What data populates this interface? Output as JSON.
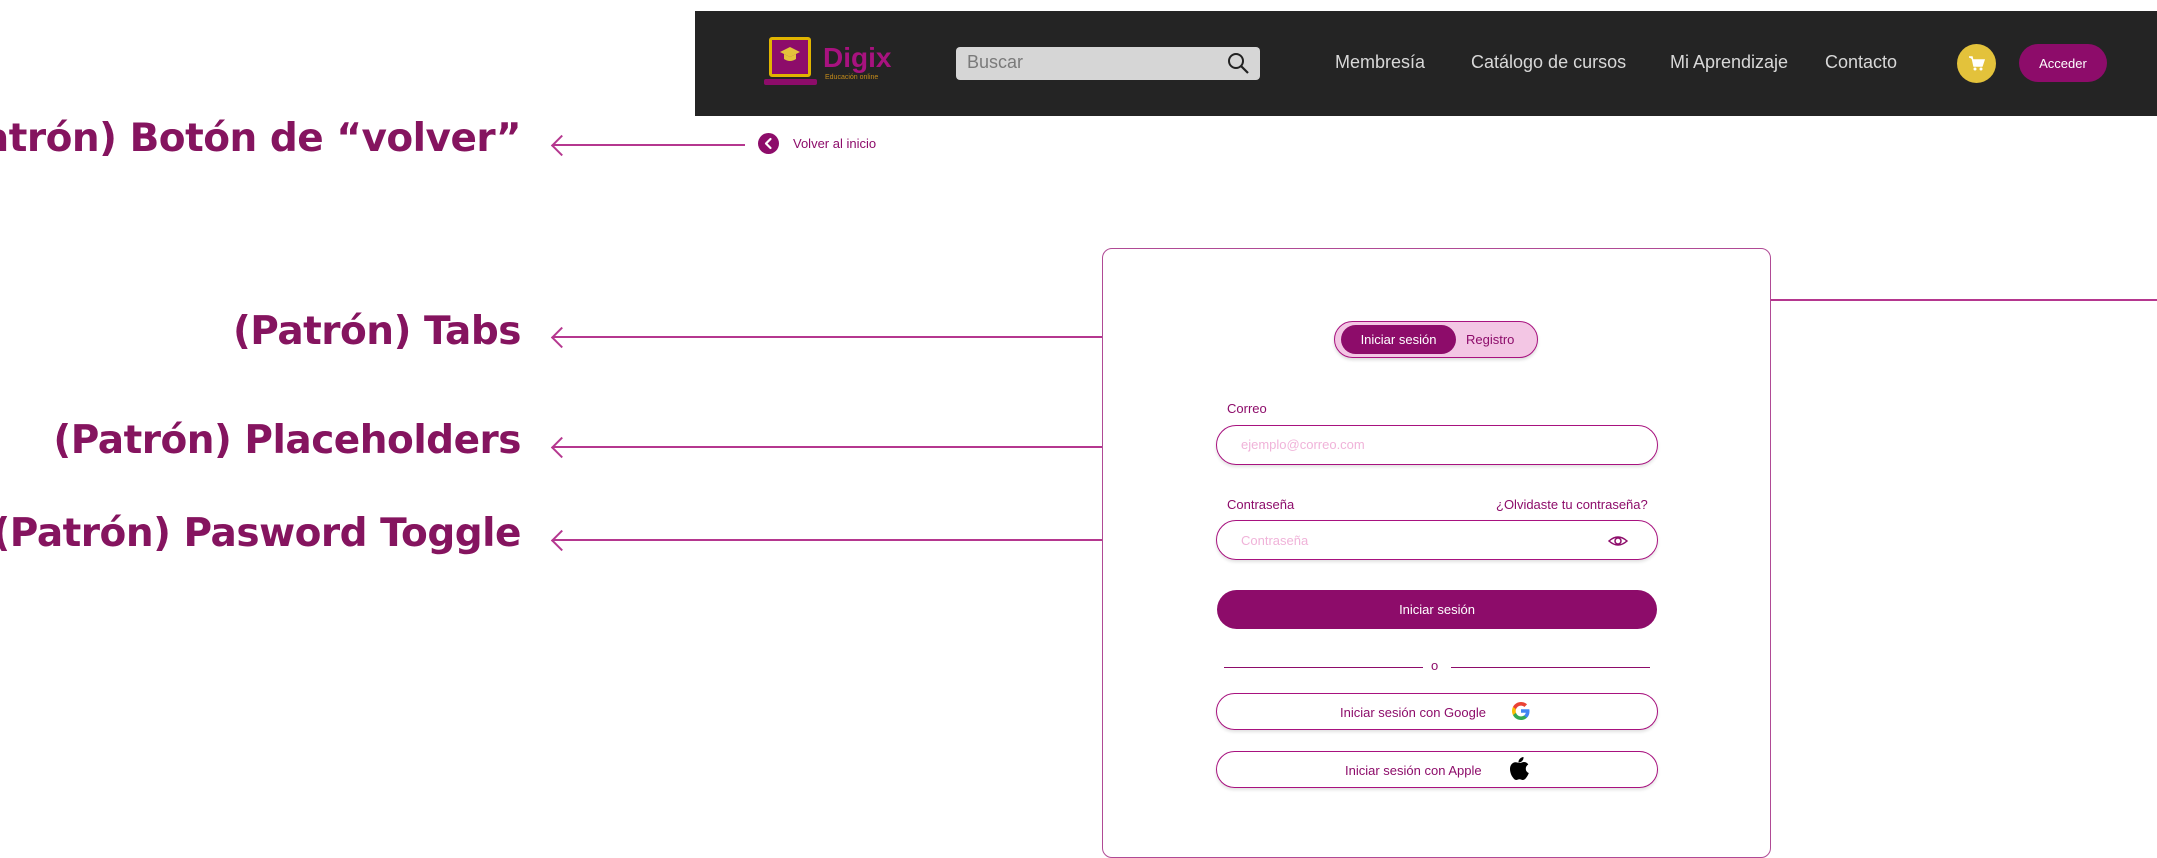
{
  "annotations": {
    "back": "(Patrón) Botón de “volver”",
    "tabs": "(Patrón) Tabs",
    "placeholders": "(Patrón) Placeholders",
    "password_toggle": "(Patrón) Pasword Toggle"
  },
  "header": {
    "logo_text": "Digix",
    "logo_subtitle": "Educación online",
    "search_placeholder": "Buscar",
    "nav": [
      "Membresía",
      "Catálogo de cursos",
      "Mi Aprendizaje",
      "Contacto"
    ],
    "login_button": "Acceder"
  },
  "back_link": "Volver al inicio",
  "login_form": {
    "tabs": [
      "Iniciar sesión",
      "Registro"
    ],
    "email_label": "Correo",
    "email_placeholder": "ejemplo@correo.com",
    "password_label": "Contraseña",
    "forgot_password": "¿Olvidaste tu contraseña?",
    "password_placeholder": "Contraseña",
    "submit": "Iniciar sesión",
    "divider_text": "o",
    "google_button": "Iniciar sesión con Google",
    "apple_button": "Iniciar sesión con Apple"
  },
  "colors": {
    "brand": "#8d0c6a",
    "header_bg": "#242424",
    "accent_yellow": "#e3c23b"
  }
}
